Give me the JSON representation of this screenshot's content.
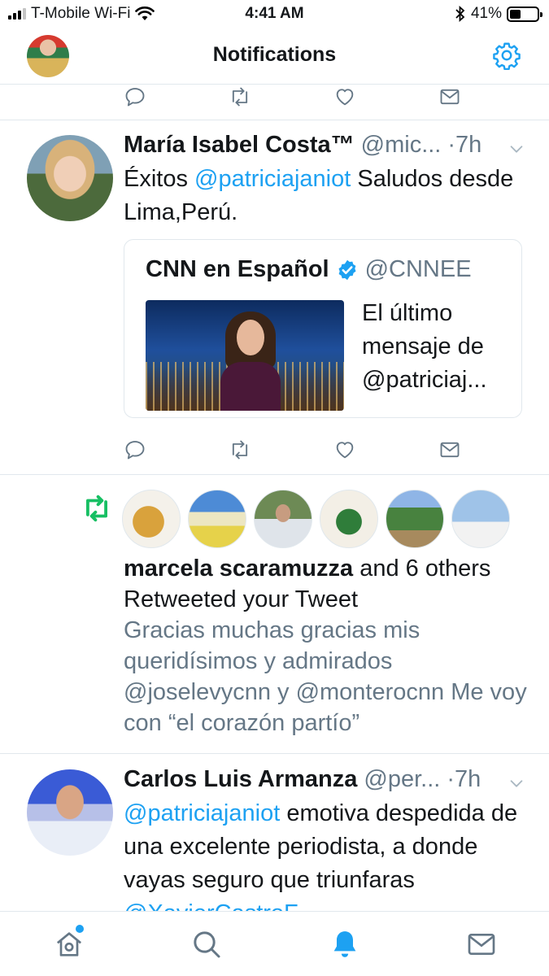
{
  "status_bar": {
    "carrier": "T-Mobile Wi-Fi",
    "time": "4:41 AM",
    "battery": "41%",
    "battery_level": 0.41
  },
  "header": {
    "title": "Notifications"
  },
  "tweet1": {
    "name": "María Isabel Costa™",
    "handle": "@mic...",
    "time": "·7h",
    "text_parts": [
      "Éxitos ",
      "@patriciajaniot",
      " Saludos desde Lima,Perú."
    ],
    "quote": {
      "name": "CNN en Español",
      "handle": "@CNNEE",
      "text": "El último mensaje de @patriciaj..."
    }
  },
  "retweet_notification": {
    "user": "marcela scaramuzza",
    "rest": " and 6 others Retweeted your Tweet",
    "tweet_text": "Gracias muchas gracias mis queridísimos y admirados @joselevycnn y @monterocnn Me voy con “el corazón partío”"
  },
  "tweet2": {
    "name": "Carlos Luis Armanza",
    "handle": "@per...",
    "time": "·7h",
    "text_parts": [
      "@patriciajaniot",
      " emotiva despedida de una excelente periodista, a donde vayas seguro que triunfaras ",
      "@XavierCastroF"
    ]
  },
  "colors": {
    "accent": "#1da1f2",
    "retweet_green": "#17bf63",
    "secondary_text": "#657786",
    "divider": "#e1e8ed"
  },
  "icons": {
    "reply": "reply-icon",
    "retweet": "retweet-icon",
    "like": "heart-icon",
    "dm": "mail-icon",
    "settings": "gear-icon",
    "home": "home-icon",
    "search": "search-icon",
    "notifications": "bell-icon",
    "messages": "envelope-icon"
  }
}
